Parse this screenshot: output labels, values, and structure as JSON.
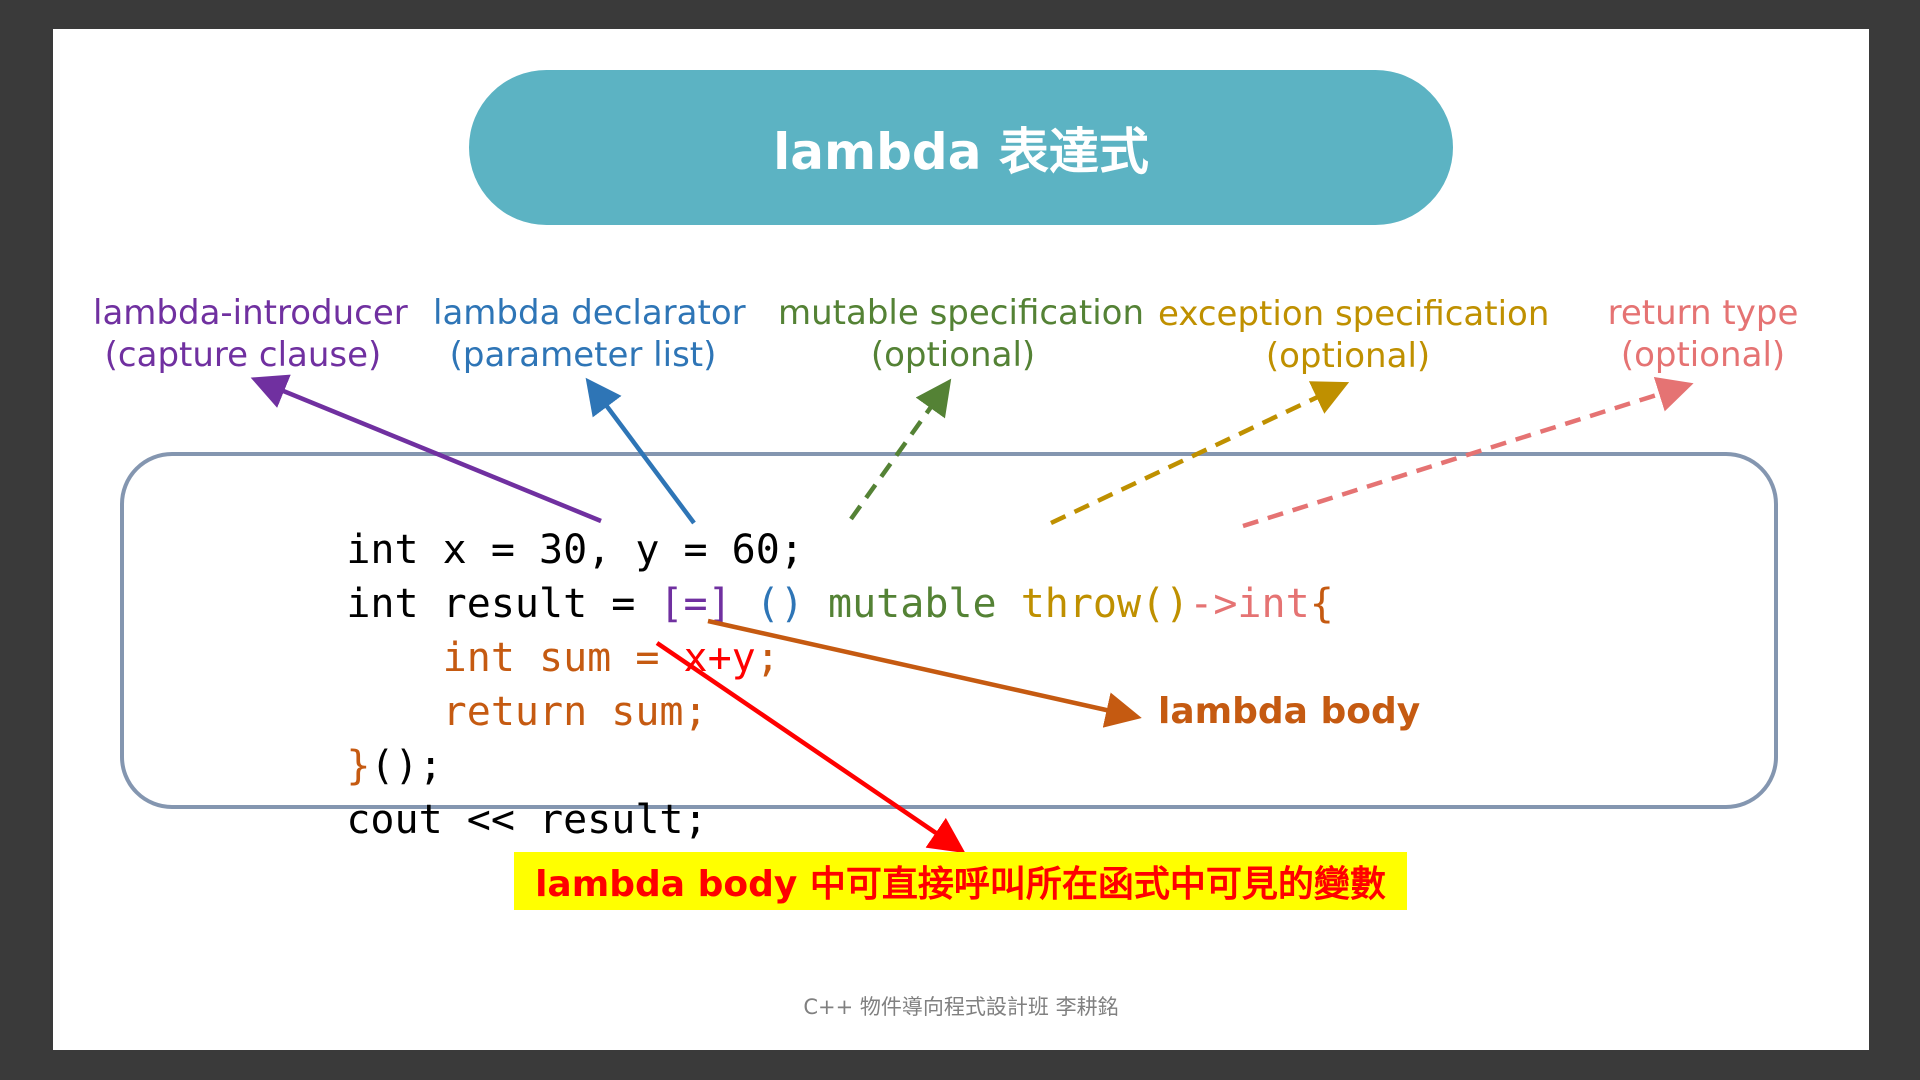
{
  "title": "lambda 表達式",
  "labels": {
    "introducer": {
      "line1": "lambda-introducer",
      "line2": "(capture clause)",
      "color": "#7030a0"
    },
    "declarator": {
      "line1": "lambda declarator",
      "line2": "(parameter list)",
      "color": "#2e75b6"
    },
    "mutable": {
      "line1": "mutable specification",
      "line2": "(optional)",
      "color": "#548235"
    },
    "exception": {
      "line1": "exception specification",
      "line2": "(optional)",
      "color": "#bf9000"
    },
    "return_type": {
      "line1": "return type",
      "line2": "(optional)",
      "color": "#e57373"
    }
  },
  "code": {
    "line1": "int x = 30, y = 60;",
    "line2": {
      "prefix": "int result = ",
      "capture": "[=]",
      "params": "()",
      "mutable": "mutable",
      "throw": "throw()",
      "arrow": "->int",
      "brace": "{"
    },
    "line3": {
      "decl": "int sum = ",
      "expr": "x+y",
      "semi": ";"
    },
    "line4": "return sum;",
    "line5": {
      "brace": "}",
      "rest": "();"
    },
    "line6": "cout << result;"
  },
  "body_label": "lambda body",
  "note": "lambda body 中可直接呼叫所在函式中可見的變數",
  "footer": "C++ 物件導向程式設計班 李耕銘",
  "colors": {
    "title_bg": "#5cb3c3",
    "code_border": "#8496b0",
    "body_orange": "#c55a11",
    "note_red": "#ff0000",
    "note_bg": "#ffff00"
  }
}
